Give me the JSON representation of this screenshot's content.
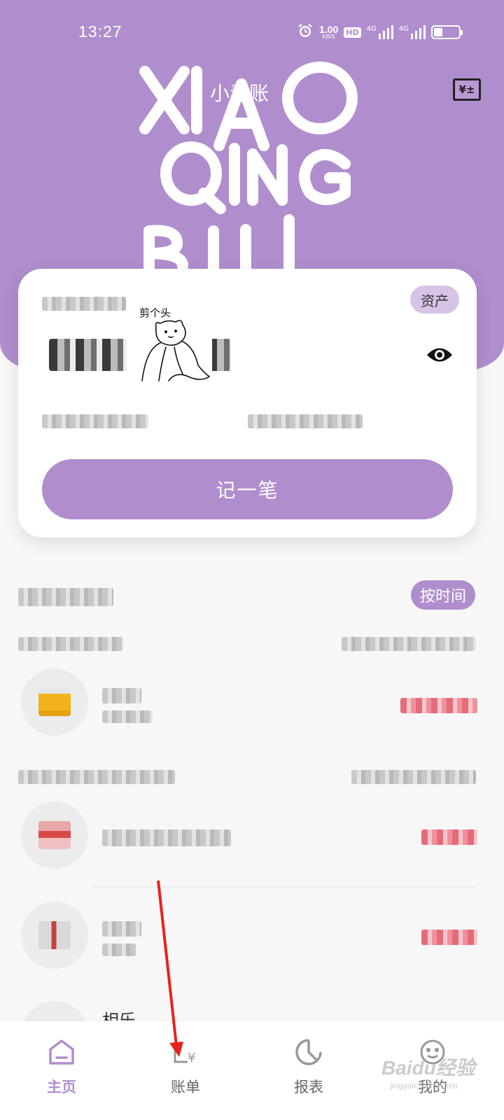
{
  "status_bar": {
    "time": "13:27",
    "net_speed": "1.00",
    "net_unit": "KB/S",
    "hd_badge": "HD",
    "signal_1": "4G",
    "signal_2": "4G",
    "battery_level": 0.35
  },
  "header": {
    "title": "小青账",
    "calc_button": "¥±",
    "decoration_text": "XIAO QING BU",
    "background_color": "#b08ece"
  },
  "summary_card": {
    "asset_button": "资产",
    "record_button": "记一笔",
    "visibility_icon": "eye-icon",
    "sticker_text": "剪个头"
  },
  "records": {
    "sort_button": "按时间",
    "partial_item_label": "相乐"
  },
  "tab_bar": {
    "active_tab": "home",
    "tabs": [
      {
        "key": "home",
        "label": "主页",
        "icon": "home-icon"
      },
      {
        "key": "bills",
        "label": "账单",
        "icon": "bill-icon"
      },
      {
        "key": "reports",
        "label": "报表",
        "icon": "chart-icon"
      },
      {
        "key": "mine",
        "label": "我的",
        "icon": "face-icon"
      }
    ],
    "accent_color": "#b08ece"
  },
  "watermark": {
    "brand": "Baidu经验",
    "site": "jingyan.baidu.com"
  }
}
